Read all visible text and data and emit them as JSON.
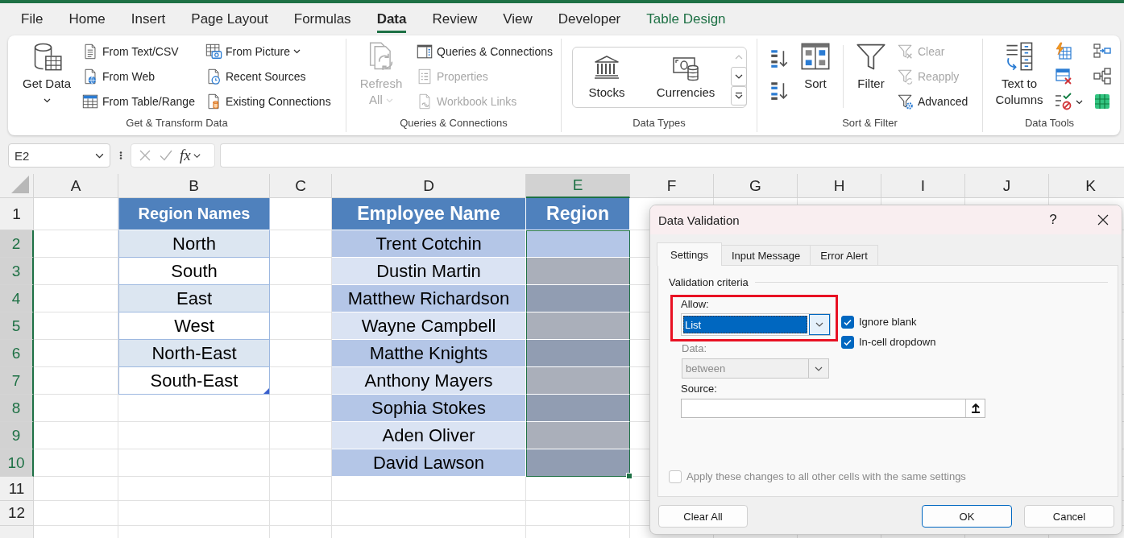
{
  "ribbon_tabs": [
    {
      "label": "File",
      "selected": false,
      "contextual": false
    },
    {
      "label": "Home",
      "selected": false,
      "contextual": false
    },
    {
      "label": "Insert",
      "selected": false,
      "contextual": false
    },
    {
      "label": "Page Layout",
      "selected": false,
      "contextual": false
    },
    {
      "label": "Formulas",
      "selected": false,
      "contextual": false
    },
    {
      "label": "Data",
      "selected": true,
      "contextual": false
    },
    {
      "label": "Review",
      "selected": false,
      "contextual": false
    },
    {
      "label": "View",
      "selected": false,
      "contextual": false
    },
    {
      "label": "Developer",
      "selected": false,
      "contextual": false
    },
    {
      "label": "Table Design",
      "selected": false,
      "contextual": true
    }
  ],
  "ribbon": {
    "groups": [
      {
        "label": "Get & Transform Data",
        "commands": [
          {
            "kind": "large",
            "label": "Get Data",
            "dropdown": true,
            "disabled": false
          },
          {
            "kind": "small",
            "label": "From Text/CSV",
            "dropdown": false,
            "disabled": false
          },
          {
            "kind": "small",
            "label": "From Web",
            "dropdown": false,
            "disabled": false
          },
          {
            "kind": "small",
            "label": "From Table/Range",
            "dropdown": false,
            "disabled": false
          },
          {
            "kind": "small",
            "label": "From Picture",
            "dropdown": true,
            "disabled": false
          },
          {
            "kind": "small",
            "label": "Recent Sources",
            "dropdown": false,
            "disabled": false
          },
          {
            "kind": "small",
            "label": "Existing Connections",
            "dropdown": false,
            "disabled": false
          }
        ]
      },
      {
        "label": "Queries & Connections",
        "commands": [
          {
            "kind": "large",
            "label": "Refresh All",
            "dropdown": true,
            "disabled": true
          },
          {
            "kind": "small",
            "label": "Queries & Connections",
            "dropdown": false,
            "disabled": false
          },
          {
            "kind": "small",
            "label": "Properties",
            "dropdown": false,
            "disabled": true
          },
          {
            "kind": "small",
            "label": "Workbook Links",
            "dropdown": false,
            "disabled": true
          }
        ]
      },
      {
        "label": "Data Types",
        "commands": [
          {
            "kind": "gallery",
            "label": "Stocks"
          },
          {
            "kind": "gallery",
            "label": "Currencies"
          }
        ]
      },
      {
        "label": "Sort & Filter",
        "commands": [
          {
            "kind": "icon",
            "dropdown": false,
            "disabled": false
          },
          {
            "kind": "icon",
            "dropdown": false,
            "disabled": false
          },
          {
            "kind": "large",
            "label": "Sort",
            "dropdown": false,
            "disabled": false
          },
          {
            "kind": "large",
            "label": "Filter",
            "dropdown": false,
            "disabled": false
          },
          {
            "kind": "small",
            "label": "Clear",
            "dropdown": false,
            "disabled": true
          },
          {
            "kind": "small",
            "label": "Reapply",
            "dropdown": false,
            "disabled": true
          },
          {
            "kind": "small",
            "label": "Advanced",
            "dropdown": false,
            "disabled": false
          }
        ]
      },
      {
        "label": "Data Tools",
        "commands": [
          {
            "kind": "large",
            "label": "Text to Columns",
            "dropdown": false,
            "disabled": false
          },
          {
            "kind": "icon",
            "dropdown": false,
            "disabled": false
          },
          {
            "kind": "icon",
            "dropdown": false,
            "disabled": false
          },
          {
            "kind": "icon",
            "dropdown": true,
            "disabled": false
          },
          {
            "kind": "icon",
            "dropdown": false,
            "disabled": false
          },
          {
            "kind": "icon",
            "dropdown": false,
            "disabled": false
          },
          {
            "kind": "icon",
            "dropdown": false,
            "disabled": false
          }
        ]
      }
    ]
  },
  "formula_bar": {
    "name_box": "E2",
    "function_button": "fx"
  },
  "sheet": {
    "columns": [
      {
        "label": "A",
        "selected": false
      },
      {
        "label": "B",
        "selected": false
      },
      {
        "label": "C",
        "selected": false
      },
      {
        "label": "D",
        "selected": false
      },
      {
        "label": "E",
        "selected": true
      },
      {
        "label": "F",
        "selected": false
      },
      {
        "label": "G",
        "selected": false
      },
      {
        "label": "H",
        "selected": false
      },
      {
        "label": "I",
        "selected": false
      },
      {
        "label": "J",
        "selected": false
      },
      {
        "label": "K",
        "selected": false
      }
    ],
    "rows": [
      {
        "label": "1",
        "selected": false
      },
      {
        "label": "2",
        "selected": true
      },
      {
        "label": "3",
        "selected": true
      },
      {
        "label": "4",
        "selected": true
      },
      {
        "label": "5",
        "selected": true
      },
      {
        "label": "6",
        "selected": true
      },
      {
        "label": "7",
        "selected": true
      },
      {
        "label": "8",
        "selected": true
      },
      {
        "label": "9",
        "selected": true
      },
      {
        "label": "10",
        "selected": true
      },
      {
        "label": "11",
        "selected": false
      },
      {
        "label": "12",
        "selected": false
      }
    ],
    "region_names": {
      "header": "Region Names",
      "items": [
        "North",
        "South",
        "East",
        "West",
        "North-East",
        "South-East"
      ]
    },
    "employees": {
      "headers": [
        "Employee Name",
        "Region"
      ],
      "rows": [
        {
          "name": "Trent Cotchin",
          "region_selected": true,
          "region_active": true
        },
        {
          "name": "Dustin Martin",
          "region_selected": true,
          "region_active": false
        },
        {
          "name": "Matthew Richardson",
          "region_selected": true,
          "region_active": false
        },
        {
          "name": "Wayne Campbell",
          "region_selected": true,
          "region_active": false
        },
        {
          "name": "Matthe Knights",
          "region_selected": true,
          "region_active": false
        },
        {
          "name": "Anthony Mayers",
          "region_selected": true,
          "region_active": false
        },
        {
          "name": "Sophia Stokes",
          "region_selected": true,
          "region_active": false
        },
        {
          "name": "Aden Oliver",
          "region_selected": true,
          "region_active": false
        },
        {
          "name": "David Lawson",
          "region_selected": true,
          "region_active": false
        }
      ]
    }
  },
  "dialog": {
    "title": "Data Validation",
    "help": "?",
    "tabs": [
      {
        "label": "Settings",
        "selected": true
      },
      {
        "label": "Input Message",
        "selected": false
      },
      {
        "label": "Error Alert",
        "selected": false
      }
    ],
    "section": "Validation criteria",
    "allow": {
      "label": "Allow:",
      "value": "List",
      "focused": true,
      "highlighted": true
    },
    "checkboxes": [
      {
        "label": "Ignore blank",
        "checked": true
      },
      {
        "label": "In-cell dropdown",
        "checked": true
      }
    ],
    "data": {
      "label": "Data:",
      "value": "between",
      "disabled": true
    },
    "source": {
      "label": "Source:"
    },
    "apply_all": {
      "label": "Apply these changes to all other cells with the same settings",
      "checked": false,
      "disabled": true
    },
    "buttons": [
      {
        "label": "Clear All",
        "default": false
      },
      {
        "label": "OK",
        "default": true
      },
      {
        "label": "Cancel",
        "default": false
      }
    ]
  }
}
